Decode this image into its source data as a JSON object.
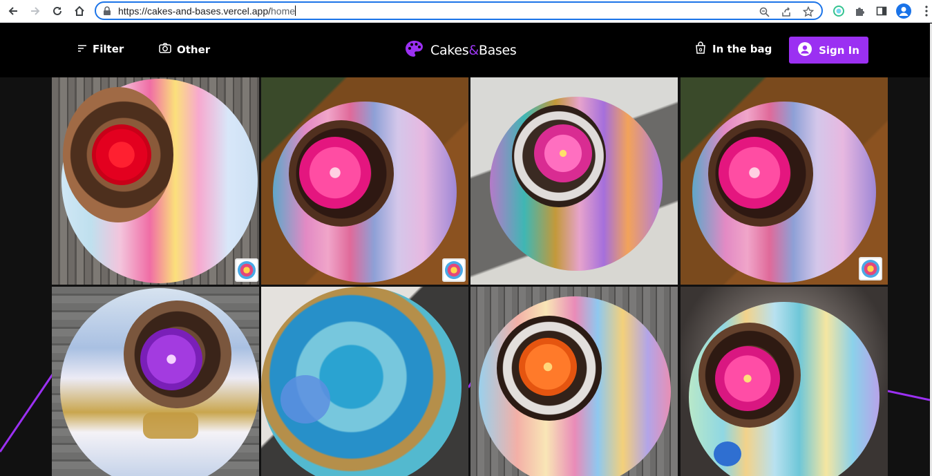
{
  "browser": {
    "url_host": "https://cakes-and-bases.vercel.app/",
    "url_path": "home"
  },
  "header": {
    "filter_label": "Filter",
    "other_label": "Other",
    "brand_part1": "Cakes",
    "brand_amp": "&",
    "brand_part2": "Bases",
    "bag_label": "In the bag",
    "signin_label": "Sign In"
  },
  "colors": {
    "accent": "#9b30f2",
    "header_bg": "#000000",
    "page_bg": "#111111"
  },
  "icons": {
    "filter": "filter-lines-icon",
    "other": "camera-icon",
    "brand": "palette-icon",
    "bag": "shopping-bag-icon",
    "signin": "user-circle-icon"
  },
  "gallery": {
    "items": [
      {
        "label": "Bundt cake with red flower on pastel painted base",
        "badge": true
      },
      {
        "label": "Chocolate bundt cake with pink flower on painted base",
        "badge": true
      },
      {
        "label": "Sugared bundt cake with pink lotus on teal base",
        "badge": false
      },
      {
        "label": "Chocolate bundt cake with pink flower on pastel base",
        "badge": true
      },
      {
        "label": "Chocolate bundt cake with purple flower on white gold base",
        "badge": false
      },
      {
        "label": "Blue and gold resin base",
        "badge": false
      },
      {
        "label": "Sugared bundt cake with orange flower on rainbow base",
        "badge": false
      },
      {
        "label": "Chocolate bundt cake with pink flower on turquoise base",
        "badge": false
      }
    ]
  }
}
